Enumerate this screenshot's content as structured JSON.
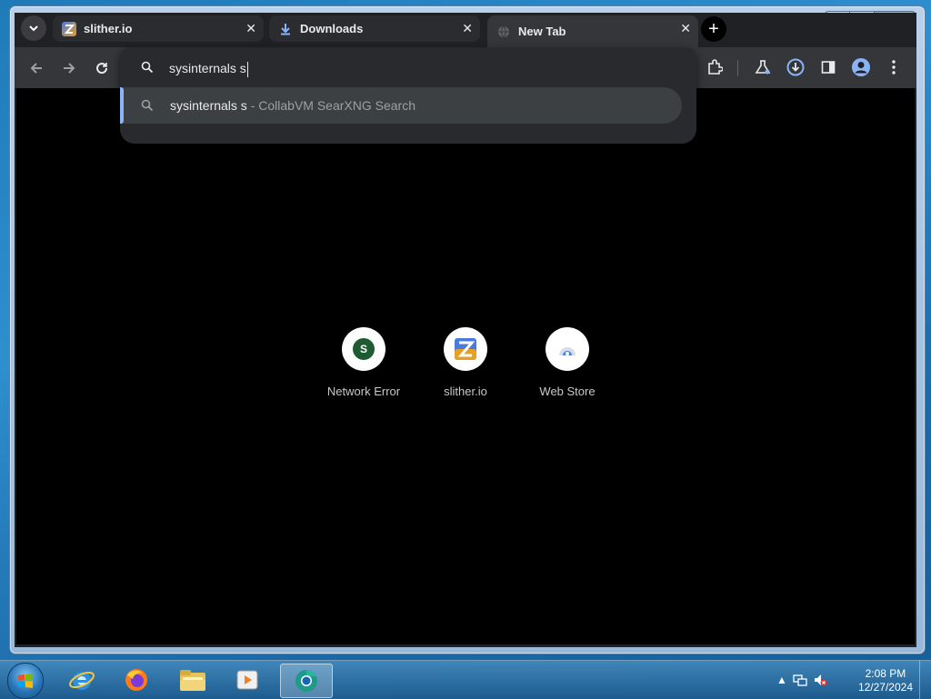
{
  "window": {
    "controls": {
      "minimize": "‒",
      "maximize": "□",
      "close": "✕"
    }
  },
  "browser": {
    "tabs": [
      {
        "title": "slither.io",
        "favicon": "slither-favicon",
        "active": false
      },
      {
        "title": "Downloads",
        "favicon": "download-icon",
        "active": false
      },
      {
        "title": "New Tab",
        "favicon": "globe-icon",
        "active": true
      }
    ],
    "tab_close_glyph": "✕",
    "new_tab_glyph": "+",
    "omnibox": {
      "value": "sysinternals s",
      "suggestion": {
        "query": "sysinternals s",
        "source": " - CollabVM SearXNG Search"
      }
    },
    "toolbar_icons": [
      "back-icon",
      "forward-icon",
      "reload-icon",
      "extensions-icon",
      "labs-icon",
      "download-icon",
      "side-panel-icon",
      "profile-icon",
      "menu-icon"
    ]
  },
  "new_tab_page": {
    "shortcuts": [
      {
        "label": "Network Error",
        "icon_letter": "S",
        "icon_color": "#1e5a32"
      },
      {
        "label": "slither.io",
        "icon_letter": "",
        "icon_color": "#e07020"
      },
      {
        "label": "Web Store",
        "icon_letter": "",
        "icon_color": "#4a80e8"
      }
    ]
  },
  "taskbar": {
    "apps": [
      "internet-explorer-icon",
      "firefox-icon",
      "file-explorer-icon",
      "media-player-icon",
      "chrome-icon"
    ],
    "clock": {
      "time": "2:08 PM",
      "date": "12/27/2024"
    }
  },
  "colors": {
    "chrome_bg": "#202124",
    "toolbar": "#35363a",
    "accent": "#8ab4f8",
    "page_bg": "#000000"
  }
}
